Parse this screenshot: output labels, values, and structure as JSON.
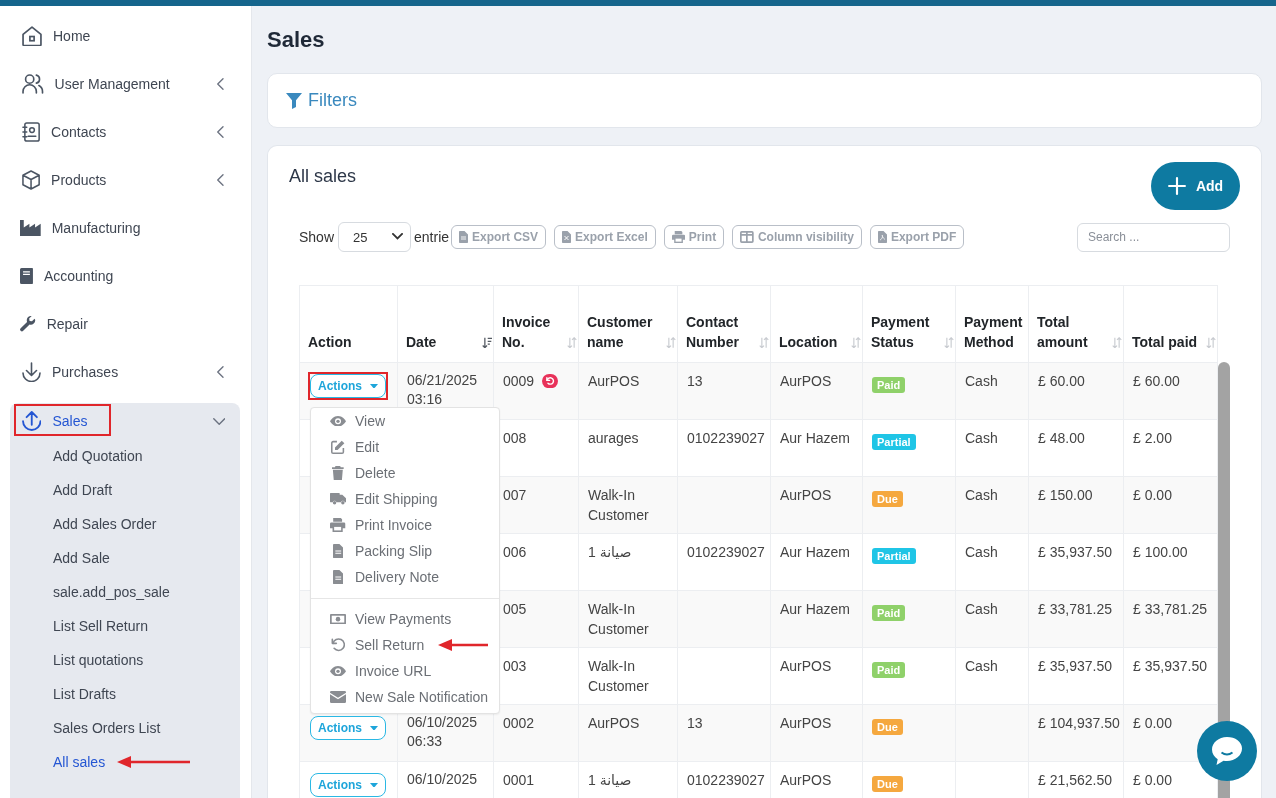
{
  "page_title": "Sales",
  "sidebar": {
    "items": [
      {
        "label": "Home",
        "selected": false,
        "highlight_box": false
      },
      {
        "label": "User Management",
        "expanded": false,
        "selected": false,
        "highlight_box": false
      },
      {
        "label": "Contacts",
        "expanded": false,
        "selected": false,
        "highlight_box": false
      },
      {
        "label": "Products",
        "expanded": false,
        "selected": false,
        "highlight_box": false
      },
      {
        "label": "Manufacturing",
        "selected": false,
        "highlight_box": false
      },
      {
        "label": "Accounting",
        "selected": false,
        "highlight_box": false
      },
      {
        "label": "Repair",
        "selected": false,
        "highlight_box": false
      },
      {
        "label": "Purchases",
        "expanded": false,
        "selected": false,
        "highlight_box": false
      },
      {
        "label": "Sales",
        "expanded": true,
        "selected": true,
        "highlight_box": true,
        "children": [
          {
            "label": "Add Quotation",
            "selected": false,
            "pointer_arrow": false
          },
          {
            "label": "Add Draft",
            "selected": false,
            "pointer_arrow": false
          },
          {
            "label": "Add Sales Order",
            "selected": false,
            "pointer_arrow": false
          },
          {
            "label": "Add Sale",
            "selected": false,
            "pointer_arrow": false
          },
          {
            "label": "sale.add_pos_sale",
            "selected": false,
            "pointer_arrow": false
          },
          {
            "label": "List Sell Return",
            "selected": false,
            "pointer_arrow": false
          },
          {
            "label": "List quotations",
            "selected": false,
            "pointer_arrow": false
          },
          {
            "label": "List Drafts",
            "selected": false,
            "pointer_arrow": false
          },
          {
            "label": "Sales Orders List",
            "selected": false,
            "pointer_arrow": false
          },
          {
            "label": "All sales",
            "selected": true,
            "pointer_arrow": true
          }
        ]
      }
    ]
  },
  "filters": {
    "label": "Filters"
  },
  "sales_card": {
    "title": "All sales",
    "add_button": "Add",
    "show_label": "Show",
    "page_size": "25",
    "entries_label": "entrie",
    "toolbar_buttons": [
      "Export CSV",
      "Export Excel",
      "Print",
      "Column visibility",
      "Export PDF"
    ],
    "search": {
      "placeholder": "Search ..."
    },
    "table": {
      "columns": [
        {
          "label": "Action",
          "sortable": false,
          "sorted": false
        },
        {
          "label": "Date",
          "sortable": true,
          "sorted": true
        },
        {
          "label": "Invoice No.",
          "sortable": true,
          "sorted": false
        },
        {
          "label": "Customer name",
          "sortable": true,
          "sorted": false
        },
        {
          "label": "Contact Number",
          "sortable": true,
          "sorted": false
        },
        {
          "label": "Location",
          "sortable": true,
          "sorted": false
        },
        {
          "label": "Payment Status",
          "sortable": true,
          "sorted": false
        },
        {
          "label": "Payment Method",
          "sortable": false,
          "sorted": false
        },
        {
          "label": "Total amount",
          "sortable": true,
          "sorted": false
        },
        {
          "label": "Total paid",
          "sortable": true,
          "sorted": false
        }
      ],
      "rows": [
        {
          "action": {
            "label": "Actions",
            "highlight_box": true,
            "menu": {
              "groups": [
                {
                  "items": [
                    {
                      "label": "View",
                      "pointer_arrow": false
                    },
                    {
                      "label": "Edit",
                      "pointer_arrow": false
                    },
                    {
                      "label": "Delete",
                      "pointer_arrow": false
                    },
                    {
                      "label": "Edit Shipping",
                      "pointer_arrow": false
                    },
                    {
                      "label": "Print Invoice",
                      "pointer_arrow": false
                    },
                    {
                      "label": "Packing Slip",
                      "pointer_arrow": false
                    },
                    {
                      "label": "Delivery Note",
                      "pointer_arrow": false
                    }
                  ]
                },
                {
                  "items": [
                    {
                      "label": "View Payments",
                      "pointer_arrow": false
                    },
                    {
                      "label": "Sell Return",
                      "pointer_arrow": true
                    },
                    {
                      "label": "Invoice URL",
                      "pointer_arrow": false
                    },
                    {
                      "label": "New Sale Notification",
                      "pointer_arrow": false
                    }
                  ]
                }
              ]
            }
          },
          "date": "06/21/2025 03:16",
          "invoice_no": "0009",
          "returned": true,
          "customer": "AurPOS",
          "contact": "13",
          "location": "AurPOS",
          "payment_status": {
            "label": "Paid",
            "color": "#8fd16a"
          },
          "payment_method": "Cash",
          "total_amount": "£ 60.00",
          "total_paid": "£ 60.00"
        },
        {
          "invoice_no": "008",
          "returned": false,
          "customer": "aurages",
          "contact": "0102239027",
          "location": "Aur Hazem",
          "payment_status": {
            "label": "Partial",
            "color": "#1fc5e6"
          },
          "payment_method": "Cash",
          "total_amount": "£ 48.00",
          "total_paid": "£ 2.00"
        },
        {
          "invoice_no": "007",
          "returned": false,
          "customer": "Walk-In Customer",
          "location": "AurPOS",
          "payment_status": {
            "label": "Due",
            "color": "#f5a83f"
          },
          "payment_method": "Cash",
          "total_amount": "£ 150.00",
          "total_paid": "£ 0.00"
        },
        {
          "invoice_no": "006",
          "returned": false,
          "customer": "صيانة 1",
          "contact": "0102239027",
          "location": "Aur Hazem",
          "payment_status": {
            "label": "Partial",
            "color": "#1fc5e6"
          },
          "payment_method": "Cash",
          "total_amount": "£ 35,937.50",
          "total_paid": "£ 100.00"
        },
        {
          "invoice_no": "005",
          "returned": false,
          "customer": "Walk-In Customer",
          "location": "Aur Hazem",
          "payment_status": {
            "label": "Paid",
            "color": "#8fd16a"
          },
          "payment_method": "Cash",
          "total_amount": "£ 33,781.25",
          "total_paid": "£ 33,781.25"
        },
        {
          "invoice_no": "003",
          "returned": false,
          "customer": "Walk-In Customer",
          "location": "AurPOS",
          "payment_status": {
            "label": "Paid",
            "color": "#8fd16a"
          },
          "payment_method": "Cash",
          "total_amount": "£ 35,937.50",
          "total_paid": "£ 35,937.50"
        },
        {
          "action": {
            "label": "Actions",
            "highlight_box": false
          },
          "date": "06/10/2025 06:33",
          "invoice_no": "0002",
          "returned": false,
          "customer": "AurPOS",
          "contact": "13",
          "location": "AurPOS",
          "payment_status": {
            "label": "Due",
            "color": "#f5a83f"
          },
          "total_amount": "£ 104,937.50",
          "total_paid": "£ 0.00"
        },
        {
          "action": {
            "label": "Actions",
            "highlight_box": false
          },
          "date": "06/10/2025",
          "invoice_no": "0001",
          "returned": false,
          "customer": "صيانة 1",
          "contact": "0102239027",
          "location": "AurPOS",
          "payment_status": {
            "label": "Due",
            "color": "#f5a83f"
          },
          "total_amount": "£ 21,562.50",
          "total_paid": "£ 0.00"
        }
      ]
    }
  }
}
